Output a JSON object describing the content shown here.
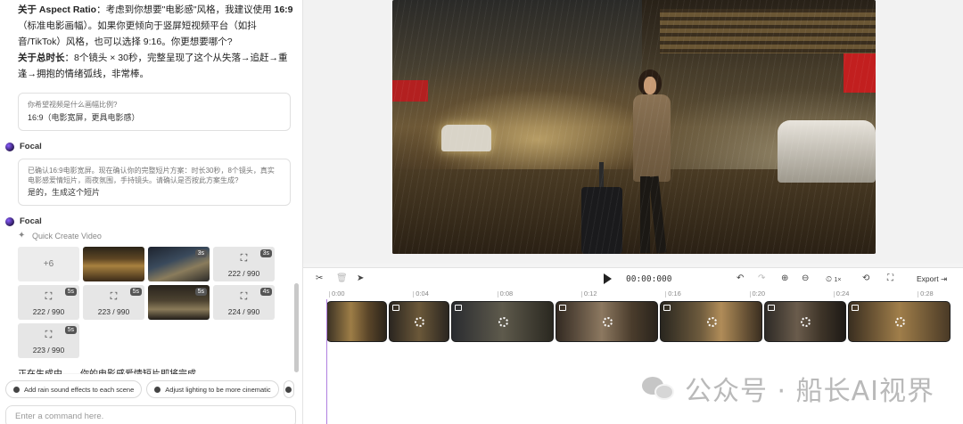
{
  "chat": {
    "intro": {
      "aspect_label": "关于 Aspect Ratio",
      "aspect_text_a": "：考虑到你想要\"电影感\"风格，我建议使用 ",
      "aspect_ratio": "16:9",
      "aspect_text_b": "（标准电影画幅）。如果你更倾向于竖屏短视频平台（如抖音/TikTok）风格，也可以选择 9:16。你更想要哪个?",
      "duration_label": "关于总时长",
      "duration_text": "：8个镜头 × 30秒，完整呈现了这个从失落→追赶→重逢→拥抱的情绪弧线，非常棒。"
    },
    "question1": {
      "question": "你希望视频是什么画幅比例?",
      "answer": "16:9（电影宽屏，更具电影感）"
    },
    "agent_name_1": "Focal",
    "question2": {
      "question": "已确认16:9电影宽屏。现在确认你的完整短片方案：时长30秒，8个镜头，真实电影感爱情短片，雨夜氛围，手持镜头。请确认是否按此方案生成?",
      "answer": "是的，生成这个短片"
    },
    "agent_name_2": "Focal",
    "quick_create": "Quick Create Video",
    "tiles": [
      {
        "kind": "more",
        "label": "+6"
      },
      {
        "kind": "image",
        "style": "img1"
      },
      {
        "kind": "image",
        "style": "img2",
        "badge": "3s"
      },
      {
        "kind": "pending",
        "badge": "3s",
        "count": "222 / 990"
      },
      {
        "kind": "pending",
        "badge": "5s",
        "count": "222 / 990"
      },
      {
        "kind": "pending",
        "badge": "5s",
        "count": "223 / 990"
      },
      {
        "kind": "image",
        "style": "img3",
        "badge": "5s"
      },
      {
        "kind": "pending",
        "badge": "4s",
        "count": "224 / 990"
      },
      {
        "kind": "pending",
        "badge": "5s",
        "count": "223 / 990"
      }
    ],
    "generating": "正在生成中——你的电影感爱情短片即将完成。",
    "suggestions": [
      "Add rain sound effects to each scene",
      "Adjust lighting to be more cinematic"
    ],
    "command_placeholder": "Enter a command here."
  },
  "timeline": {
    "time": "00:00:000",
    "zoom": "1×",
    "export": "Export",
    "ruler": [
      "0:00",
      "0:04",
      "0:08",
      "0:12",
      "0:16",
      "0:20",
      "0:24",
      "0:28"
    ],
    "clips": [
      {
        "style": "c1",
        "tag": false,
        "spin": false
      },
      {
        "style": "c2",
        "tag": true,
        "spin": true
      },
      {
        "style": "c3",
        "tag": true,
        "spin": true
      },
      {
        "style": "c4",
        "tag": true,
        "spin": true
      },
      {
        "style": "c5",
        "tag": true,
        "spin": true
      },
      {
        "style": "c6",
        "tag": true,
        "spin": true
      },
      {
        "style": "c7",
        "tag": true,
        "spin": true
      }
    ]
  },
  "watermark": "公众号 · 船长AI视界",
  "colors": {
    "playhead": "#b07fe0",
    "agent_dot": "#5b3fd0"
  }
}
